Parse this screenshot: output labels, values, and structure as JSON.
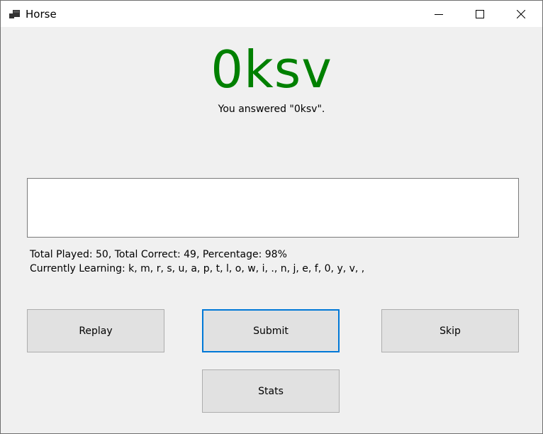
{
  "window": {
    "title": "Horse"
  },
  "quiz": {
    "display_answer": "0ksv",
    "feedback": "You answered \"0ksv\".",
    "input_value": ""
  },
  "stats": {
    "summary": "Total Played: 50, Total Correct: 49, Percentage: 98%",
    "learning": "Currently Learning: k, m, r, s, u, a, p, t, l, o, w, i, ., n, j, e, f, 0, y, v, ,"
  },
  "buttons": {
    "replay": "Replay",
    "submit": "Submit",
    "skip": "Skip",
    "stats": "Stats"
  },
  "colors": {
    "answer_green": "#008000",
    "focus_blue": "#0078d7",
    "button_face": "#e1e1e1",
    "window_bg": "#f0f0f0"
  },
  "icons": {
    "app": "app-window-icon",
    "minimize": "minimize-icon",
    "maximize": "maximize-icon",
    "close": "close-icon"
  }
}
